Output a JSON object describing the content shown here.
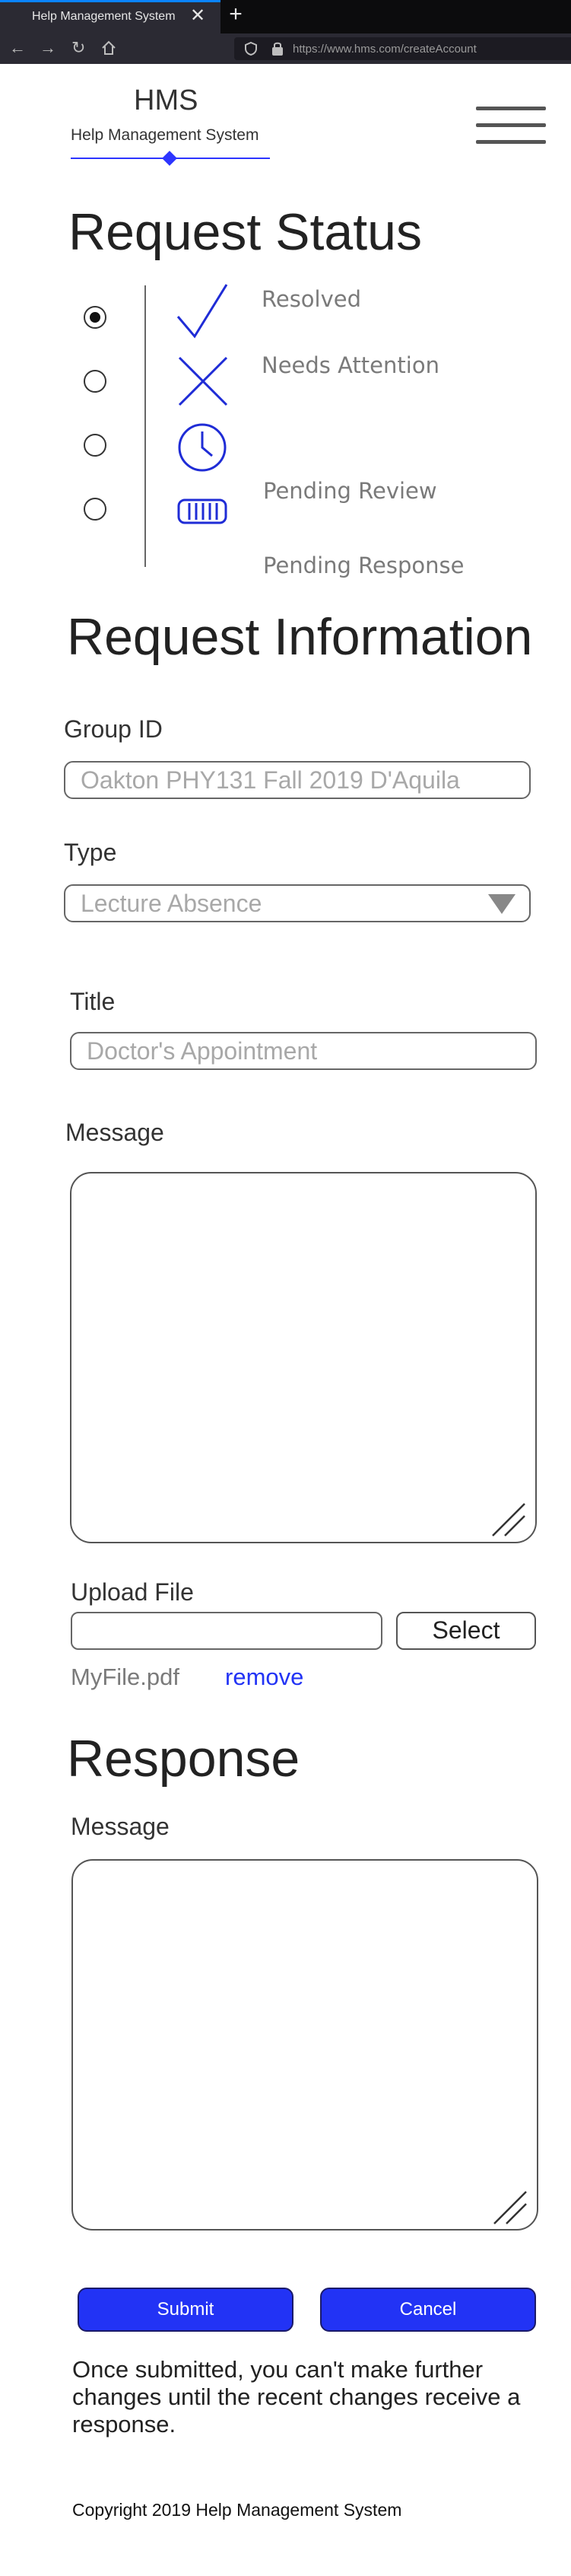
{
  "browser": {
    "tab_title": "Help Management System",
    "tab_close": "✕",
    "new_tab": "+",
    "url": "https://www.hms.com/createAccount"
  },
  "header": {
    "logo": "HMS",
    "subtitle": "Help Management System"
  },
  "status": {
    "title": "Request Status",
    "selected_index": 0,
    "labels": [
      "Resolved",
      "Needs Attention",
      "Pending Review",
      "Pending Response"
    ],
    "icons": [
      "checkmark-icon",
      "x-mark-icon",
      "clock-icon",
      "progress-bar-icon"
    ]
  },
  "info": {
    "title": "Request Information",
    "group_label": "Group ID",
    "group_placeholder": "Oakton PHY131 Fall 2019 D'Aquila",
    "type_label": "Type",
    "type_value": "Lecture Absence",
    "title_label": "Title",
    "title_placeholder": "Doctor's Appointment",
    "message_label": "Message",
    "upload_label": "Upload File",
    "select_label": "Select",
    "file_name": "MyFile.pdf",
    "remove_label": "remove"
  },
  "response": {
    "title": "Response",
    "message_label": "Message"
  },
  "actions": {
    "submit": "Submit",
    "cancel": "Cancel",
    "note": "Once submitted, you can't make further changes until the recent changes receive a response."
  },
  "footer": {
    "copyright": "Copyright 2019 Help Management System"
  },
  "colors": {
    "accent": "#2233f5",
    "icon_blue": "#1f2cd6"
  }
}
